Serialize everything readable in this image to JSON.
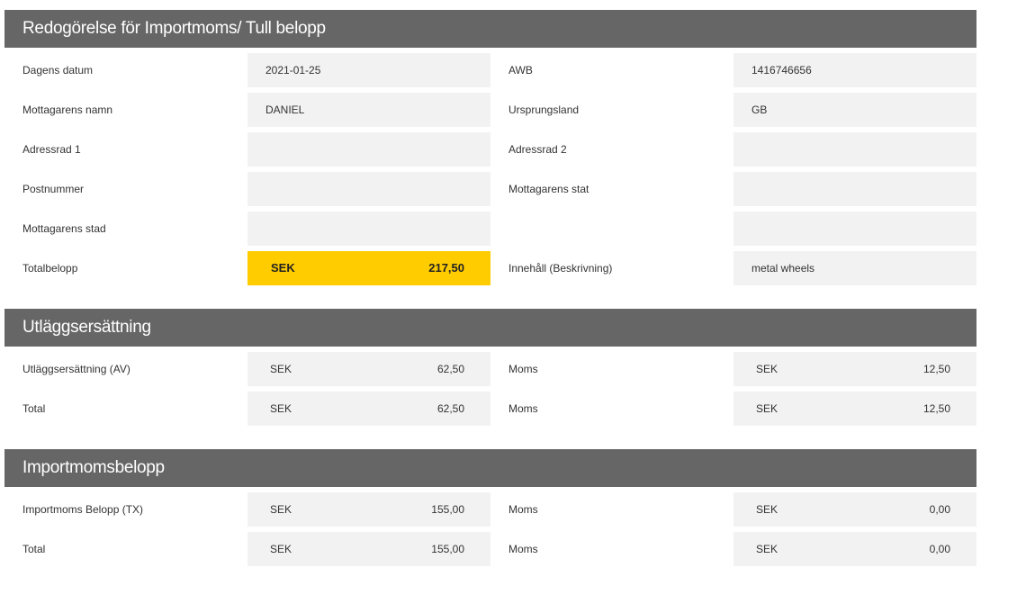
{
  "sections": [
    {
      "title": "Redogörelse för Importmoms/ Tull belopp",
      "rows": [
        {
          "label_left": "Dagens datum",
          "value_left": "2021-01-25",
          "label_right": "AWB",
          "value_right": "1416746656"
        },
        {
          "label_left": "Mottagarens namn",
          "value_left": "DANIEL",
          "label_right": "Ursprungsland",
          "value_right": "GB"
        },
        {
          "label_left": "Adressrad 1",
          "value_left": "",
          "label_right": "Adressrad 2",
          "value_right": ""
        },
        {
          "label_left": "Postnummer",
          "value_left": "",
          "label_right": "Mottagarens stat",
          "value_right": ""
        },
        {
          "label_left": "Mottagarens stad",
          "value_left": "",
          "label_right": "",
          "value_right": ""
        }
      ],
      "total_row": {
        "label_left": "Totalbelopp",
        "currency": "SEK",
        "amount": "217,50",
        "label_right": "Innehåll (Beskrivning)",
        "value_right": "metal wheels"
      }
    },
    {
      "title": "Utläggsersättning",
      "rows": [
        {
          "label_left": "Utläggsersättning (AV)",
          "currency_left": "SEK",
          "amount_left": "62,50",
          "label_right": "Moms",
          "currency_right": "SEK",
          "amount_right": "12,50"
        },
        {
          "label_left": "Total",
          "currency_left": "SEK",
          "amount_left": "62,50",
          "label_right": "Moms",
          "currency_right": "SEK",
          "amount_right": "12,50"
        }
      ]
    },
    {
      "title": "Importmomsbelopp",
      "rows": [
        {
          "label_left": "Importmoms Belopp (TX)",
          "currency_left": "SEK",
          "amount_left": "155,00",
          "label_right": "Moms",
          "currency_right": "SEK",
          "amount_right": "0,00"
        },
        {
          "label_left": "Total",
          "currency_left": "SEK",
          "amount_left": "155,00",
          "label_right": "Moms",
          "currency_right": "SEK",
          "amount_right": "0,00"
        }
      ]
    }
  ],
  "colors": {
    "header_bg": "#666666",
    "field_bg": "#f2f2f2",
    "highlight_bg": "#ffcc00"
  }
}
